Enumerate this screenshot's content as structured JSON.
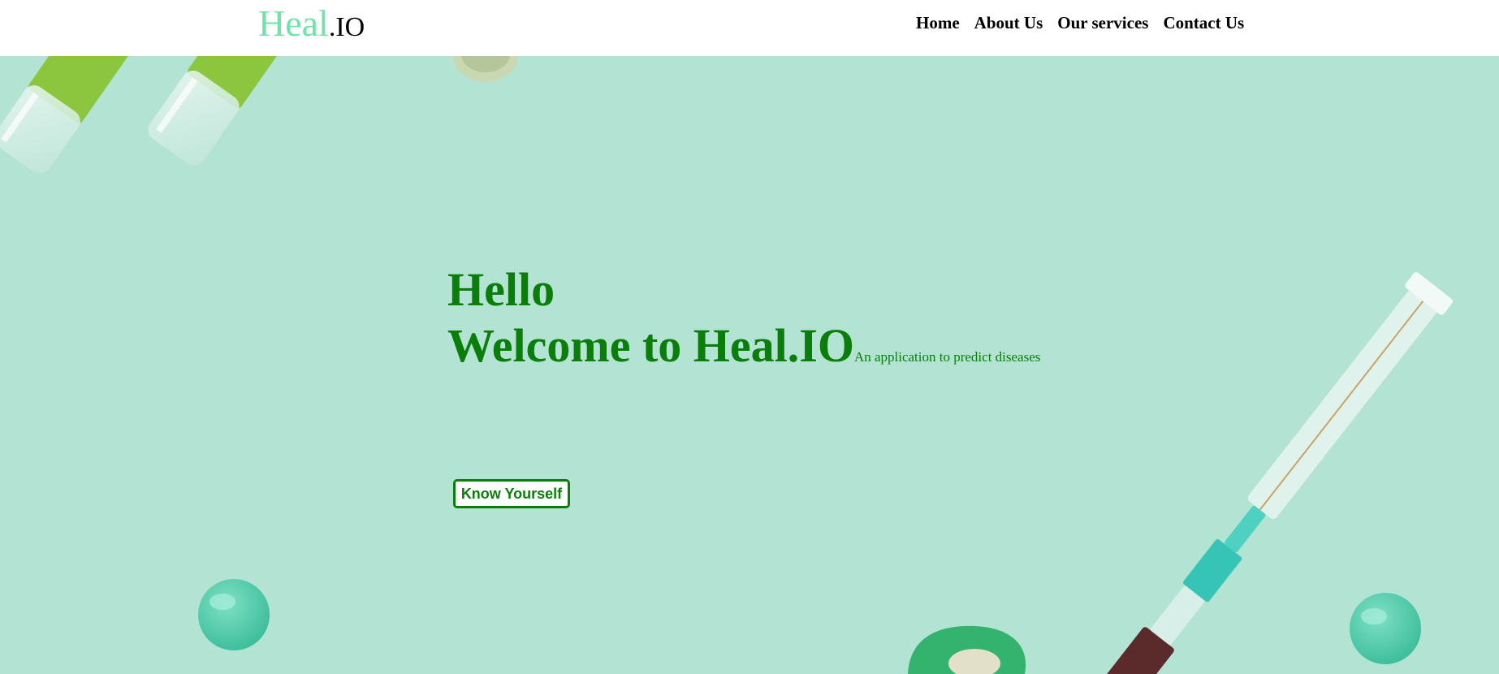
{
  "header": {
    "logo": {
      "part1": "Heal",
      "part2": ".IO"
    },
    "nav": [
      {
        "label": "Home"
      },
      {
        "label": "About Us"
      },
      {
        "label": "Our services"
      },
      {
        "label": "Contact Us"
      }
    ]
  },
  "hero": {
    "greeting": "Hello",
    "welcome": "Welcome to Heal.IO",
    "tagline": "An application to predict diseases",
    "cta_label": "Know Yourself",
    "background_image": "mint-background-with-vials-pills-syringe"
  },
  "colors": {
    "accent_green": "#0b7d0b",
    "logo_mint": "#6fe3a8",
    "hero_background": "#b3e3d2"
  }
}
